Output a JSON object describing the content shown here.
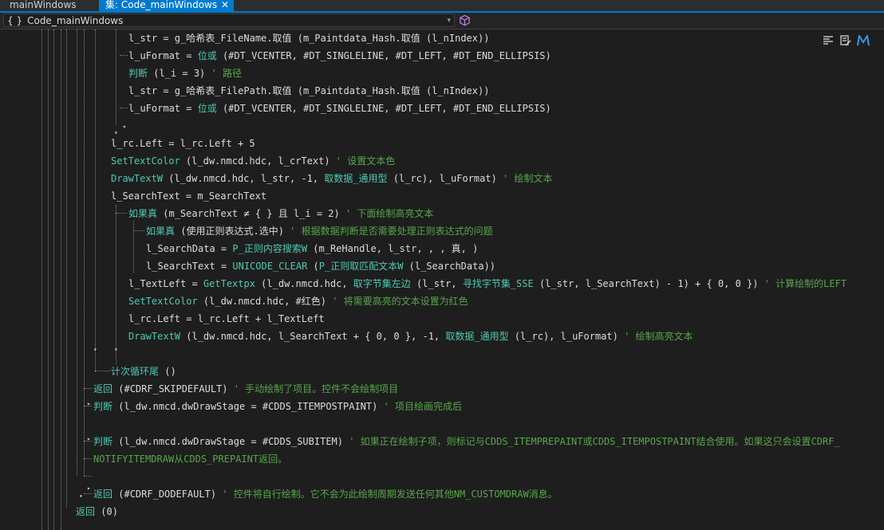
{
  "tabs": {
    "inactive": "mainWindows",
    "active": "集: Code_mainWindows",
    "close": "✕"
  },
  "nav": {
    "braces": "{ }",
    "scope": "Code_mainWindows",
    "caret": "▾"
  },
  "lines": [
    [
      {
        "t": "l_str = g_哈希表_FileName.取值 (m_Paintdata_Hash.取值 (l_nIndex))",
        "c": ""
      }
    ],
    [
      {
        "t": "l_uFormat = ",
        "c": ""
      },
      {
        "t": "位或",
        "c": "kw"
      },
      {
        "t": " (#DT_VCENTER, #DT_SINGLELINE, #DT_LEFT, #DT_END_ELLIPSIS)",
        "c": ""
      }
    ],
    [
      {
        "t": "判断",
        "c": "kw"
      },
      {
        "t": " (l_i = 3) ",
        "c": ""
      },
      {
        "t": "' 路径",
        "c": "cmt"
      }
    ],
    [
      {
        "t": "l_str = g_哈希表_FilePath.取值 (m_Paintdata_Hash.取值 (l_nIndex))",
        "c": ""
      }
    ],
    [
      {
        "t": "l_uFormat = ",
        "c": ""
      },
      {
        "t": "位或",
        "c": "kw"
      },
      {
        "t": " (#DT_VCENTER, #DT_SINGLELINE, #DT_LEFT, #DT_END_ELLIPSIS)",
        "c": ""
      }
    ],
    [],
    [
      {
        "t": "l_rc.Left = l_rc.Left + 5",
        "c": ""
      }
    ],
    [
      {
        "t": "SetTextColor",
        "c": "kw"
      },
      {
        "t": " (l_dw.nmcd.hdc, l_crText) ",
        "c": ""
      },
      {
        "t": "' 设置文本色",
        "c": "cmt"
      }
    ],
    [
      {
        "t": "DrawTextW",
        "c": "kw"
      },
      {
        "t": " (l_dw.nmcd.hdc, l_str, -1, ",
        "c": ""
      },
      {
        "t": "取数据_通用型",
        "c": "kw"
      },
      {
        "t": " (l_rc), l_uFormat) ",
        "c": ""
      },
      {
        "t": "' 绘制文本",
        "c": "cmt"
      }
    ],
    [
      {
        "t": "l_SearchText = m_SearchText",
        "c": ""
      }
    ],
    [
      {
        "t": "如果真",
        "c": "kw"
      },
      {
        "t": " (m_SearchText ≠ { } 且 l_i = 2) ",
        "c": ""
      },
      {
        "t": "' 下面绘制高亮文本",
        "c": "cmt"
      }
    ],
    [
      {
        "t": "如果真",
        "c": "kw"
      },
      {
        "t": " (使用正则表达式.选中) ",
        "c": ""
      },
      {
        "t": "' 根据数据判断是否需要处理正则表达式的问题",
        "c": "cmt"
      }
    ],
    [
      {
        "t": "l_SearchData = ",
        "c": ""
      },
      {
        "t": "P_正则内容搜索W",
        "c": "kw"
      },
      {
        "t": " (m_ReHandle, l_str, , , 真, )",
        "c": ""
      }
    ],
    [
      {
        "t": "l_SearchText = ",
        "c": ""
      },
      {
        "t": "UNICODE_CLEAR",
        "c": "kw"
      },
      {
        "t": " (",
        "c": ""
      },
      {
        "t": "P_正则取匹配文本W",
        "c": "kw"
      },
      {
        "t": " (l_SearchData))",
        "c": ""
      }
    ],
    [
      {
        "t": "l_TextLeft = ",
        "c": ""
      },
      {
        "t": "GetTextpx",
        "c": "kw"
      },
      {
        "t": " (l_dw.nmcd.hdc, ",
        "c": ""
      },
      {
        "t": "取字节集左边",
        "c": "kw"
      },
      {
        "t": " (l_str, ",
        "c": ""
      },
      {
        "t": "寻找字节集_SSE",
        "c": "kw"
      },
      {
        "t": " (l_str, l_SearchText) - 1) + { 0, 0 }) ",
        "c": ""
      },
      {
        "t": "' 计算绘制的LEFT",
        "c": "cmt"
      }
    ],
    [
      {
        "t": "SetTextColor",
        "c": "kw"
      },
      {
        "t": " (l_dw.nmcd.hdc, #红色) ",
        "c": ""
      },
      {
        "t": "' 将需要高亮的文本设置为红色",
        "c": "cmt"
      }
    ],
    [
      {
        "t": "l_rc.Left = l_rc.Left + l_TextLeft",
        "c": ""
      }
    ],
    [
      {
        "t": "DrawTextW",
        "c": "kw"
      },
      {
        "t": " (l_dw.nmcd.hdc, l_SearchText + { 0, 0 }, -1, ",
        "c": ""
      },
      {
        "t": "取数据_通用型",
        "c": "kw"
      },
      {
        "t": " (l_rc), l_uFormat) ",
        "c": ""
      },
      {
        "t": "' 绘制高亮文本",
        "c": "cmt"
      }
    ],
    [],
    [
      {
        "t": "计次循环尾",
        "c": "kw"
      },
      {
        "t": " ()",
        "c": ""
      }
    ],
    [
      {
        "t": "返回",
        "c": "kw"
      },
      {
        "t": " (#CDRF_SKIPDEFAULT) ",
        "c": ""
      },
      {
        "t": "' 手动绘制了项目。控件不会绘制项目",
        "c": "cmt"
      }
    ],
    [
      {
        "t": "判断",
        "c": "kw"
      },
      {
        "t": " (l_dw.nmcd.dwDrawStage = #CDDS_ITEMPOSTPAINT) ",
        "c": ""
      },
      {
        "t": "' 项目绘画完成后",
        "c": "cmt"
      }
    ],
    [],
    [
      {
        "t": "判断",
        "c": "kw"
      },
      {
        "t": " (l_dw.nmcd.dwDrawStage = #CDDS_SUBITEM) ",
        "c": ""
      },
      {
        "t": "' 如果正在绘制子项，则标记与CDDS_ITEMPREPAINT或CDDS_ITEMPOSTPAINT结合使用。如果这只会设置CDRF_",
        "c": "cmt"
      }
    ],
    [
      {
        "t": "NOTIFYITEMDRAW从CDDS_PREPAINT返回。",
        "c": "cmt"
      }
    ],
    [],
    [
      {
        "t": "返回",
        "c": "kw"
      },
      {
        "t": " (#CDRF_DODEFAULT) ",
        "c": ""
      },
      {
        "t": "' 控件将自行绘制。它不会为此绘制周期发送任何其他NM_CUSTOMDRAW消息。",
        "c": "cmt"
      }
    ],
    [
      {
        "t": "返回",
        "c": "kw"
      },
      {
        "t": " (0)",
        "c": ""
      }
    ]
  ],
  "tools": [
    "format-icon",
    "edit-icon",
    "module-m-icon"
  ],
  "colors": {
    "keyword": "#4ec9b0",
    "comment": "#57a64a",
    "text": "#dcdcdc",
    "accent": "#007acc",
    "tool_m": "#3a96dd"
  }
}
